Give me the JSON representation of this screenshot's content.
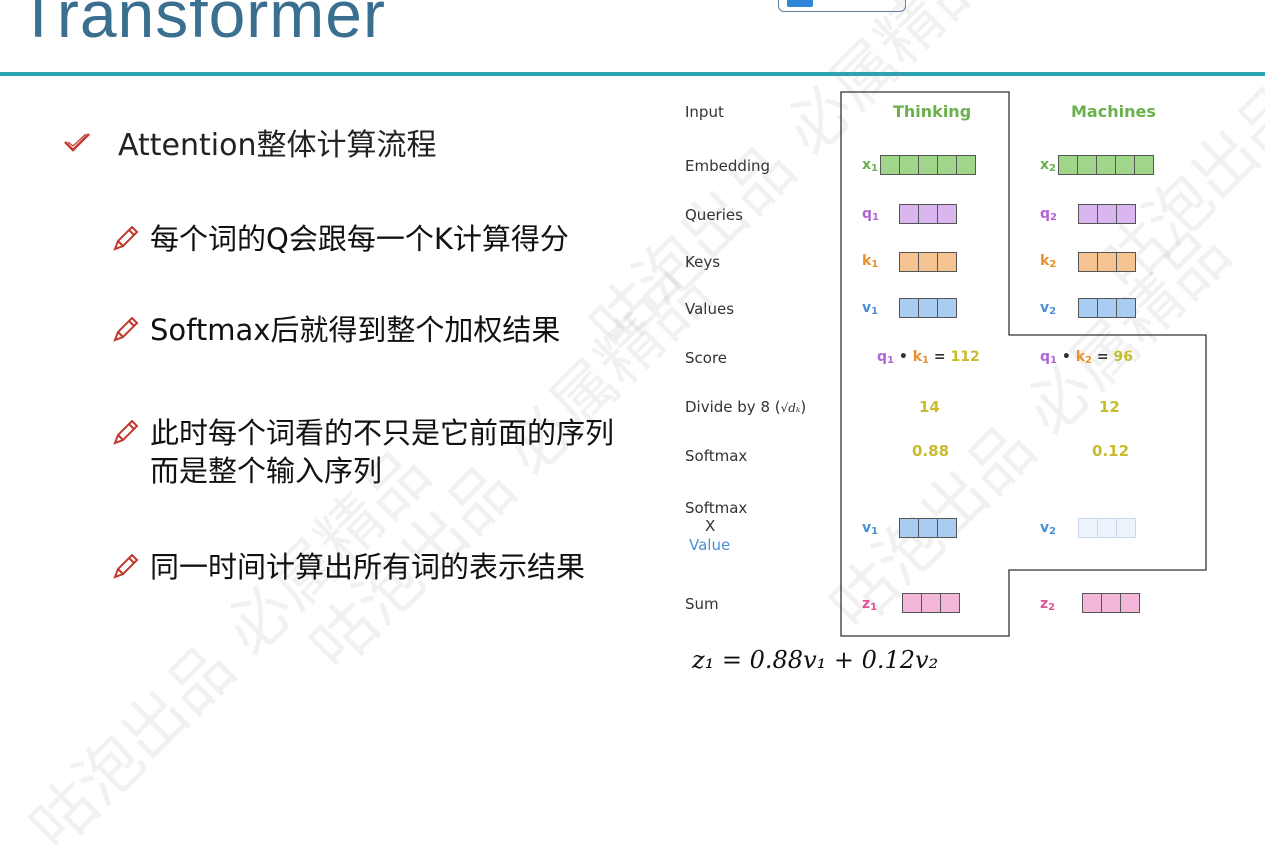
{
  "title": "Transformer",
  "heading": "Attention整体计算流程",
  "bullets": [
    {
      "line1": "每个词的Q会跟每一个K计算得分"
    },
    {
      "line1": "Softmax后就得到整个加权结果"
    },
    {
      "line1": "此时每个词看的不只是它前面的序列",
      "line2": "而是整个输入序列"
    },
    {
      "line1": "同一时间计算出所有词的表示结果"
    }
  ],
  "diagram": {
    "row_labels": {
      "input": "Input",
      "embedding": "Embedding",
      "queries": "Queries",
      "keys": "Keys",
      "values": "Values",
      "score": "Score",
      "divide": "Divide by 8 (",
      "divide_end": ")",
      "sqrt": "√dₖ",
      "softmax": "Softmax",
      "softmax_x_1": "Softmax",
      "softmax_x_2": "X",
      "softmax_x_3": "Value",
      "sum": "Sum"
    },
    "columns": [
      {
        "word": "Thinking",
        "x": "x",
        "x_sub": "1",
        "q": "q",
        "q_sub": "1",
        "k": "k",
        "k_sub": "1",
        "v": "v",
        "v_sub": "1",
        "score_q": "q",
        "score_q_sub": "1",
        "score_k": "k",
        "score_k_sub": "1",
        "score_value": "112",
        "divided": "14",
        "softmax": "0.88",
        "wv": "v",
        "wv_sub": "1",
        "z": "z",
        "z_sub": "1"
      },
      {
        "word": "Machines",
        "x": "x",
        "x_sub": "2",
        "q": "q",
        "q_sub": "2",
        "k": "k",
        "k_sub": "2",
        "v": "v",
        "v_sub": "2",
        "score_q": "q",
        "score_q_sub": "1",
        "score_k": "k",
        "score_k_sub": "2",
        "score_value": "96",
        "divided": "12",
        "softmax": "0.12",
        "wv": "v",
        "wv_sub": "2",
        "z": "z",
        "z_sub": "2"
      }
    ],
    "dot": "•",
    "equals": "=",
    "formula": "z₁ = 0.88v₁ + 0.12v₂"
  },
  "watermark": "咕泡出品 必属精品",
  "colors": {
    "title": "#3a6f8f",
    "topbar": "#2aa3b1",
    "embedding": "#9fd68a",
    "query": "#d9b6ee",
    "key": "#f6c393",
    "value": "#a9cdf2",
    "value_faded": "#eef4fb",
    "sum": "#f3b6d9",
    "number": "#c7bc2d",
    "heading_green": "#6ab04c"
  }
}
